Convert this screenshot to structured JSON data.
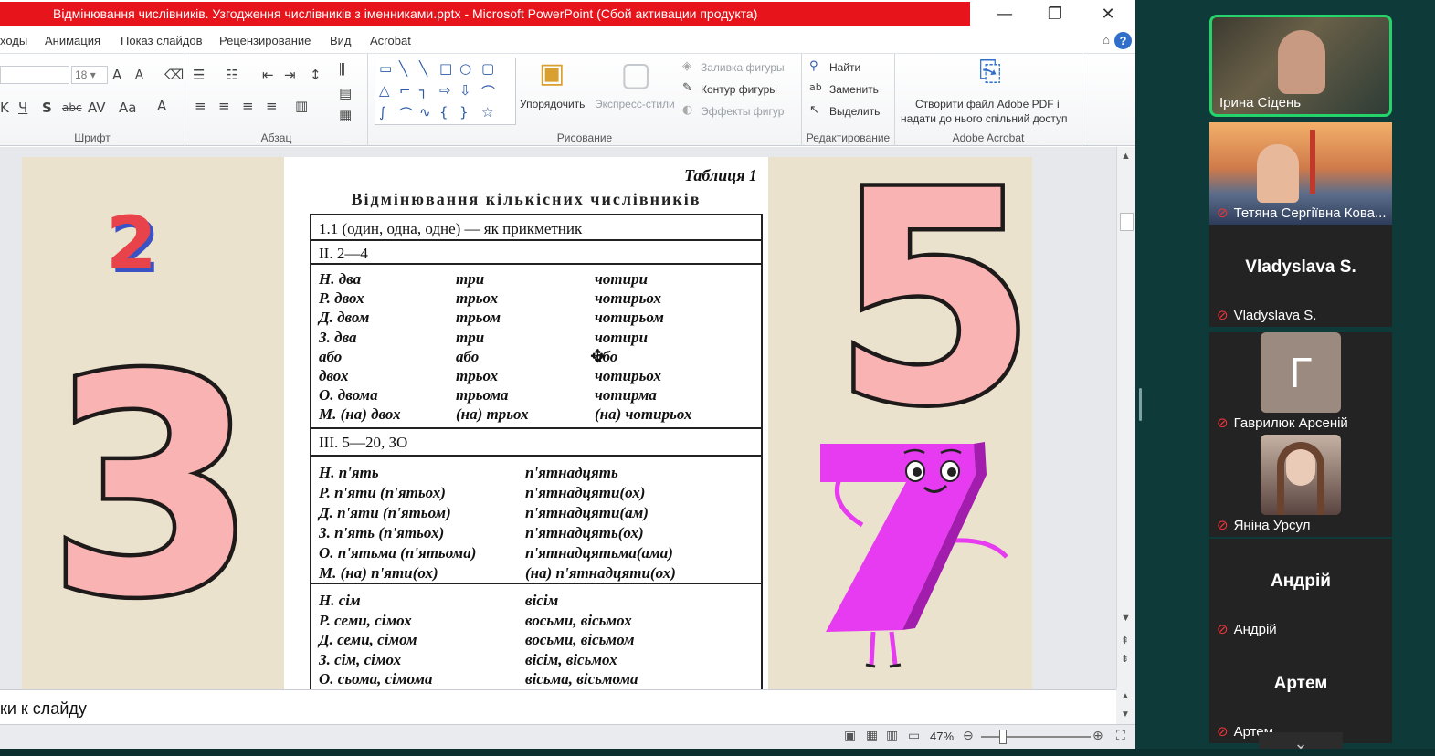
{
  "window": {
    "title": "Відмінювання числівників. Узгодження числівників з іменниками.pptx - Microsoft PowerPoint (Сбой активации продукта)",
    "minimize": "—",
    "restore": "❐",
    "close": "✕"
  },
  "tabs": [
    "ходы",
    "Анимация",
    "Показ слайдов",
    "Рецензирование",
    "Вид",
    "Acrobat"
  ],
  "ribbon": {
    "font_size": "18",
    "groups": {
      "font": "Шрифт",
      "paragraph": "Абзац",
      "drawing": "Рисование",
      "editing": "Редактирование",
      "acrobat": "Adobe Acrobat"
    },
    "arrange": "Упорядочить",
    "express_styles": "Экспресс-стили",
    "shape_fill": "Заливка фигуры",
    "shape_outline": "Контур фигуры",
    "shape_effects": "Эффекты фигур",
    "find": "Найти",
    "replace": "Заменить",
    "select": "Выделить",
    "acrobat_line1": "Створити файл Adobe PDF і",
    "acrobat_line2": "надати до нього спільний доступ"
  },
  "slide": {
    "table_number": "Таблиця 1",
    "table_title": "Відмінювання кількісних числівників",
    "section1": "1.1 (один, одна, одне) — як прикметник",
    "section2": "II. 2—4",
    "rows_2_4": [
      [
        "Н. два",
        "три",
        "чотири"
      ],
      [
        "Р. двох",
        "трьох",
        "чотирьох"
      ],
      [
        "Д. двом",
        "трьом",
        "чотирьом"
      ],
      [
        "З. два",
        "три",
        "чотири"
      ],
      [
        "або",
        "або",
        "або"
      ],
      [
        "двох",
        "трьох",
        "чотирьох"
      ],
      [
        "О. двома",
        "трьома",
        "чотирма"
      ],
      [
        "М. (на) двох",
        "(на) трьох",
        "(на) чотирьох"
      ]
    ],
    "section3": "III. 5—20, ЗО",
    "rows_5_20": [
      [
        "Н. п'ять",
        "п'ятнадцять"
      ],
      [
        "Р. п'яти (п'ятьох)",
        "п'ятнадцяти(ох)"
      ],
      [
        "Д. п'яти (п'ятьом)",
        "п'ятнадцяти(ам)"
      ],
      [
        "З. п'ять (п'ятьох)",
        "п'ятнадцять(ох)"
      ],
      [
        "О. п'ятьма (п'ятьома)",
        "п'ятнадцятьма(ама)"
      ],
      [
        "М. (на) п'яти(ох)",
        "(на) п'ятнадцяти(ох)"
      ]
    ],
    "rows_7_8": [
      [
        "Н. сім",
        "вісім"
      ],
      [
        "Р. семи, сімох",
        "восьми, вісьмох"
      ],
      [
        "Д. семи, сімом",
        "восьми, вісьмом"
      ],
      [
        "З. сім, сімох",
        "вісім, вісьмох"
      ],
      [
        "О. сьома, сімома",
        "вісьма, вісьмома"
      ]
    ],
    "num_two": "2",
    "num_three": "3",
    "num_five": "5",
    "num_seven": "7"
  },
  "notes_text": "ки к слайду",
  "status": {
    "zoom": "47%"
  },
  "participants": [
    {
      "name": "Ірина Сідень",
      "muted": false,
      "kind": "video",
      "active": true
    },
    {
      "name": "Тетяна Сергіївна Кова...",
      "muted": true,
      "kind": "video"
    },
    {
      "name": "Vladyslava S.",
      "display": "Vladyslava S.",
      "muted": true,
      "kind": "name"
    },
    {
      "name": "Гаврилюк Арсеній",
      "initial": "Г",
      "muted": true,
      "kind": "initial"
    },
    {
      "name": "Яніна Урсул",
      "muted": true,
      "kind": "photo"
    },
    {
      "name": "Андрій",
      "display": "Андрій",
      "muted": true,
      "kind": "name"
    },
    {
      "name": "Артем",
      "display": "Артем",
      "muted": true,
      "kind": "name"
    }
  ],
  "colors": {
    "title_bar": "#e8141b",
    "slide_bg": "#ebe2cd",
    "pink": "#f9b3b3",
    "magenta": "#e63bf0",
    "two_red": "#e8434a",
    "two_blue": "#3a52c4",
    "active_border": "#24d36a",
    "mute_red": "#e8353a"
  }
}
